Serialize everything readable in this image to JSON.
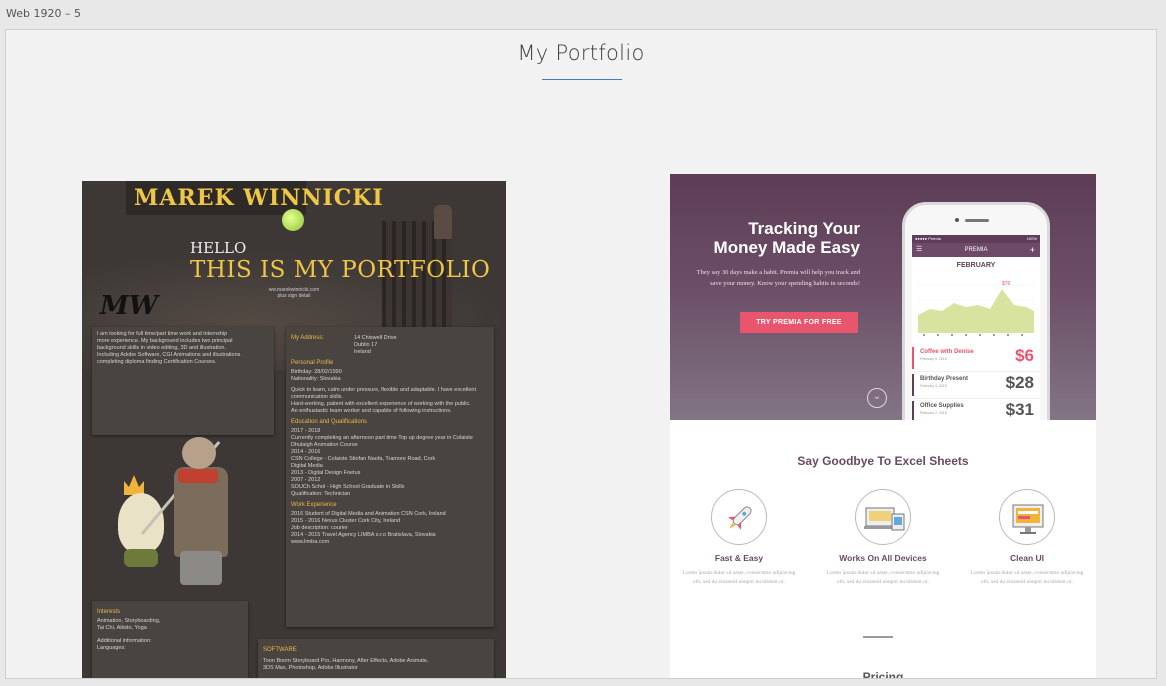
{
  "artboard": {
    "label": "Web 1920 – 5"
  },
  "page": {
    "title": "My Portfolio",
    "accent_color": "#4a78d8"
  },
  "cv_card": {
    "name": "MAREK WINNICKI",
    "hello": "HELLO",
    "headline": "THIS IS MY PORTFOLIO",
    "logo": "MW",
    "contact": "ww.marekwinnicki.com\nplus sign detail",
    "about": "I am looking for full time/part time work and internship\nmore experience. My background includes two principal\nbackground skills in video editing, 3D and illustration.\nIncluding Adobe Software, CGI Animations and illustrations\ncompleting diploma finding Certification Courses.",
    "address_label": "My Address:",
    "address": "14 Chiswell Drive\nDublin 17\nIreland",
    "personal_label": "Personal Profile",
    "personal": "Birthday: 28/02/1990\nNationality: Slovakia",
    "skills_list": "Quick to learn, calm under pressure, flexible and adaptable. I have excellent communication skills.\nHard-working, patient with excellent experience of working with the public.\nAn enthusiastic team worker and capable of following instructions.",
    "education_label": "Education and Qualifications",
    "education": "2017 - 2018\nCurrently completing an afternoon part time Top up degree year in Colaiste Dhulaigh Animation Course\n2014 - 2016\nCSN College - Colaiste Stiofan Naofa, Tramore Road, Cork\nDigital Media\n2013 - Digital Design Foetus\n2007 - 2012\nSOUCh Schol - High School Graduate in Skills\nQualification: Technician",
    "work_label": "Work Experience",
    "work": "2016 Student of Digital Media and Animation CSN Cork, Ireland\n2015 - 2016 Nexus Cluster Cork City, Ireland\nJob description: courier\n2014 - 2015 Travel Agency LIMBA s.r.o Bratislava, Slovakia\nwww.limba.com",
    "interests_label": "Interests",
    "interests": "Animation, Storyboarding,\nTai Chi, Aikido, Yoga",
    "additional_label": "Additional information:",
    "additional": "Languages:",
    "skills_label": "Software",
    "software": "Toon Boom Storyboard Pro, Harmony, After Effects, Adobe Animate,\n3DS Max, Photoshop, Adobe Illustrator"
  },
  "app_card": {
    "hero_title": "Tracking Your Money Made Easy",
    "hero_subtitle": "They say 30 days make a habit. Premia will help you track and save your money. Know your spending habits in seconds!",
    "cta_label": "TRY PREMIA FOR FREE",
    "cta_color": "#e8556c",
    "scroll_icon": "chevron-down-icon",
    "phone": {
      "status_left": "●●●●● Premia",
      "status_right": "100%",
      "app_title": "PREMIA",
      "month": "FEBRUARY",
      "chart_label": "$76",
      "expenses": [
        {
          "name": "Coffee with Denise",
          "date": "February 5, 2015",
          "amount": "$6"
        },
        {
          "name": "Birthday Present",
          "date": "February 4, 2015",
          "amount": "$28"
        },
        {
          "name": "Office Supplies",
          "date": "February 2, 2015",
          "amount": "$31"
        }
      ]
    },
    "section_title": "Say Goodbye To Excel Sheets",
    "features": [
      {
        "icon": "rocket-icon",
        "title": "Fast & Easy",
        "text": "Lorem ipsum dolor sit amet, consectetur adipiscing elit, sed do eiusmod tempor incididunt ut."
      },
      {
        "icon": "devices-icon",
        "title": "Works On All Devices",
        "text": "Lorem ipsum dolor sit amet, consectetur adipiscing elit, sed do eiusmod tempor incididunt ut."
      },
      {
        "icon": "monitor-icon",
        "title": "Clean UI",
        "text": "Lorem ipsum dolor sit amet, consectetur adipiscing elit, sed do eiusmod tempor incididunt ut."
      }
    ],
    "pricing_title": "Pricing"
  }
}
